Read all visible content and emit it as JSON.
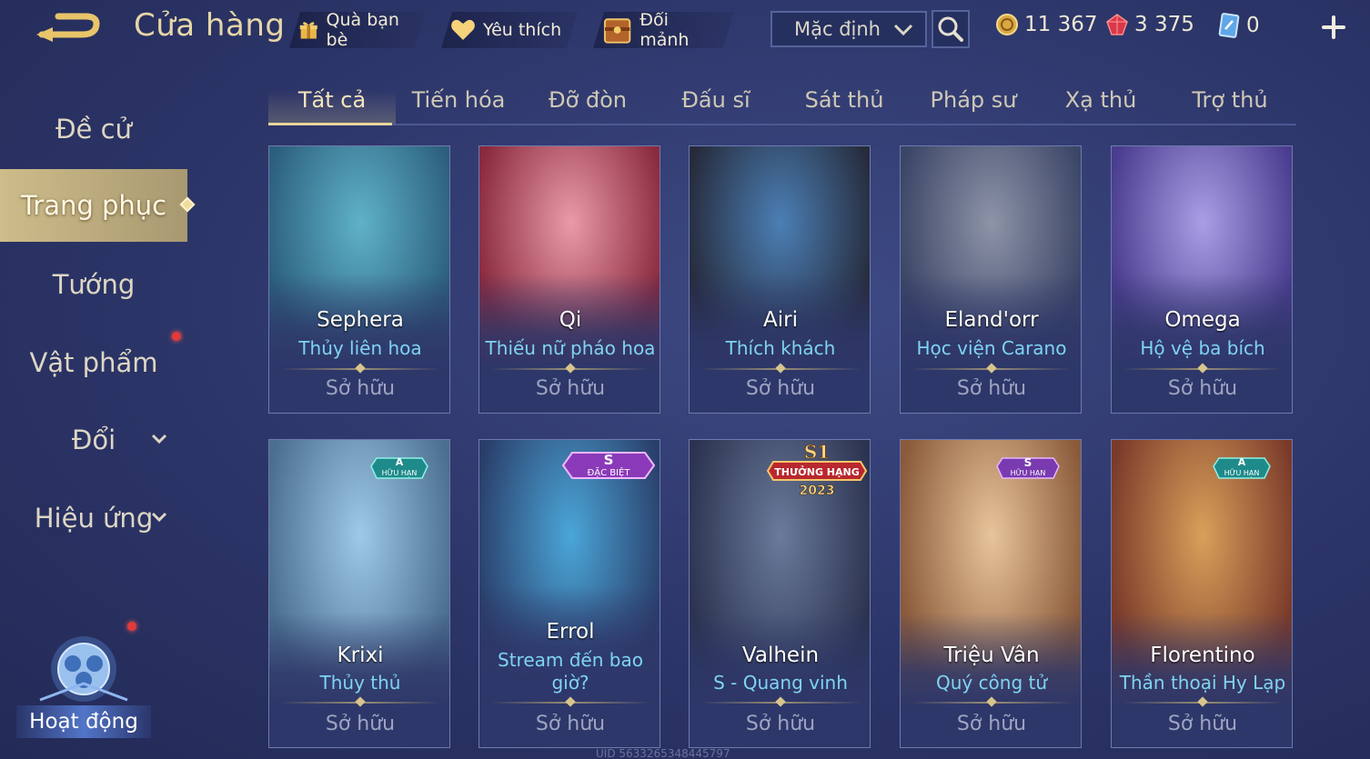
{
  "header": {
    "title": "Cửa hàng",
    "chips": {
      "gift": "Quà bạn bè",
      "favorite": "Yêu thích",
      "shard": "Đổi mảnh"
    },
    "sort_select": "Mặc định",
    "currencies": {
      "gold": "11 367",
      "gem": "3 375",
      "ticket": "0"
    },
    "icons": {
      "back": "back-arrow-icon",
      "search": "search-icon",
      "plus": "plus-icon"
    }
  },
  "sidebar": {
    "items": [
      {
        "label": "Đề cử"
      },
      {
        "label": "Trang phục"
      },
      {
        "label": "Tướng"
      },
      {
        "label": "Vật phẩm"
      },
      {
        "label": "Đổi"
      },
      {
        "label": "Hiệu ứng"
      }
    ],
    "activity": "Hoạt động"
  },
  "tabs": [
    "Tất cả",
    "Tiến hóa",
    "Đỡ đòn",
    "Đấu sĩ",
    "Sát thủ",
    "Pháp sư",
    "Xạ thủ",
    "Trợ thủ"
  ],
  "cards": [
    {
      "hero": "Sephera",
      "skin": "Thủy liên hoa",
      "status": "Sở hữu",
      "colors": [
        "#5fb2c9",
        "#2c5f7d"
      ]
    },
    {
      "hero": "Qi",
      "skin": "Thiếu nữ pháo hoa",
      "status": "Sở hữu",
      "colors": [
        "#e99aa8",
        "#8a2a3e"
      ]
    },
    {
      "hero": "Airi",
      "skin": "Thích khách",
      "status": "Sở hữu",
      "colors": [
        "#4b7fb5",
        "#262b3c"
      ]
    },
    {
      "hero": "Eland'orr",
      "skin": "Học viện Carano",
      "status": "Sở hữu",
      "colors": [
        "#8d94a8",
        "#3b4566"
      ]
    },
    {
      "hero": "Omega",
      "skin": "Hộ vệ ba bích",
      "status": "Sở hữu",
      "colors": [
        "#aa9ee6",
        "#4a3c8e"
      ]
    },
    {
      "hero": "Krixi",
      "skin": "Thủy thủ",
      "status": "Sở hữu",
      "badge": {
        "grade": "A",
        "text": "HỮU HẠN"
      },
      "colors": [
        "#9ec9e8",
        "#4a6e8e"
      ]
    },
    {
      "hero": "Errol",
      "skin": "Stream đến bao giờ?",
      "status": "Sở hữu",
      "badge": {
        "grade": "S",
        "text": "ĐẶC BIỆT"
      },
      "colors": [
        "#4aa6d8",
        "#2a3e6a"
      ]
    },
    {
      "hero": "Valhein",
      "skin": "S - Quang vinh",
      "status": "Sở hữu",
      "badge": {
        "grade": "S1",
        "text": "THƯỞNG HẠNG",
        "year": "2023"
      },
      "colors": [
        "#6a7a9a",
        "#2b3350"
      ]
    },
    {
      "hero": "Triệu Vân",
      "skin": "Quý công tử",
      "status": "Sở hữu",
      "badge": {
        "grade": "S",
        "text": "HỮU HẠN"
      },
      "colors": [
        "#e8c49a",
        "#8a5a3a"
      ]
    },
    {
      "hero": "Florentino",
      "skin": "Thần thoại Hy Lạp",
      "status": "Sở hữu",
      "badge": {
        "grade": "A",
        "text": "HỮU HẠN"
      },
      "colors": [
        "#d8a05a",
        "#7a3a2a"
      ]
    }
  ],
  "footer": {
    "uid": "UID 5633265348445797"
  }
}
